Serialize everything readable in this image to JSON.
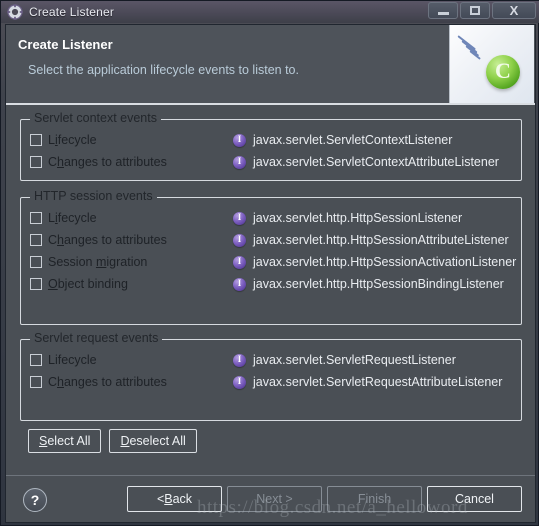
{
  "window": {
    "title": "Create Listener",
    "icon": "gear-icon",
    "buttons": {
      "minimize": "–",
      "maximize": "□",
      "close": "X"
    }
  },
  "header": {
    "title": "Create Listener",
    "subtitle": "Select the application lifecycle events to listen to.",
    "banner_letter": "C"
  },
  "groups": [
    {
      "label": "Servlet context events",
      "rows": [
        {
          "checkbox_label": "Lifecycle",
          "mnemonic_index": 1,
          "checked": false,
          "interface": "javax.servlet.ServletContextListener"
        },
        {
          "checkbox_label": "Changes to attributes",
          "mnemonic_index": 1,
          "checked": false,
          "interface": "javax.servlet.ServletContextAttributeListener"
        }
      ]
    },
    {
      "label": "HTTP session events",
      "rows": [
        {
          "checkbox_label": "Lifecycle",
          "mnemonic_index": 1,
          "checked": false,
          "interface": "javax.servlet.http.HttpSessionListener"
        },
        {
          "checkbox_label": "Changes to attributes",
          "mnemonic_index": 1,
          "checked": false,
          "interface": "javax.servlet.http.HttpSessionAttributeListener"
        },
        {
          "checkbox_label": "Session migration",
          "mnemonic_index": 8,
          "checked": false,
          "interface": "javax.servlet.http.HttpSessionActivationListener"
        },
        {
          "checkbox_label": "Object binding",
          "mnemonic_index": 0,
          "checked": false,
          "interface": "javax.servlet.http.HttpSessionBindingListener"
        }
      ]
    },
    {
      "label": "Servlet request events",
      "rows": [
        {
          "checkbox_label": "Lifecycle",
          "mnemonic_index": -1,
          "checked": false,
          "interface": "javax.servlet.ServletRequestListener"
        },
        {
          "checkbox_label": "Changes to attributes",
          "mnemonic_index": 1,
          "checked": false,
          "interface": "javax.servlet.ServletRequestAttributeListener"
        }
      ]
    }
  ],
  "selection_buttons": [
    {
      "label": "Select All",
      "mnemonic_index": 0,
      "enabled": true
    },
    {
      "label": "Deselect All",
      "mnemonic_index": 0,
      "enabled": true
    }
  ],
  "footer": {
    "help_glyph": "?",
    "buttons": [
      {
        "label": "< Back",
        "mnemonic_index": 2,
        "enabled": true
      },
      {
        "label": "Next >",
        "mnemonic_index": -1,
        "enabled": false
      },
      {
        "label": "Finish",
        "mnemonic_index": -1,
        "enabled": false
      },
      {
        "label": "Cancel",
        "mnemonic_index": -1,
        "enabled": true
      }
    ]
  },
  "watermark": "https://blog.csdn.net/a_helloword",
  "colors": {
    "dialog_background": "#4a4f55",
    "header_background": "#4e535a",
    "title_text": "#ffffff",
    "subtitle_text": "#b9cbd8",
    "group_border": "#d6dadf",
    "interface_icon": "#7f62c2",
    "banner_green": "#8fd14a"
  }
}
